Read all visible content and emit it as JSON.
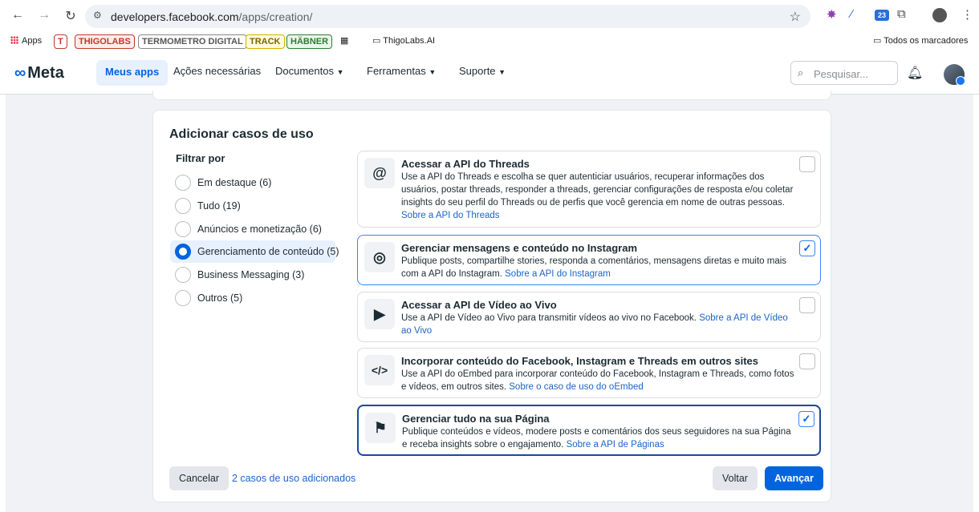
{
  "browser": {
    "url_domain": "developers.facebook.com",
    "url_path": "/apps/creation/",
    "bookmarks": [
      {
        "label": "Apps"
      },
      {
        "label": "T"
      },
      {
        "label": "THIGOLABS"
      },
      {
        "label": "TERMOMETRO DIGITAL"
      },
      {
        "label": "TRACK"
      },
      {
        "label": "HÄBNER"
      },
      {
        "label": "ThigoLabs.AI"
      }
    ],
    "all_bookmarks": "Todos os marcadores",
    "ext_badge": "23"
  },
  "header": {
    "logo": "Meta",
    "nav": [
      "Meus apps",
      "Ações necessárias",
      "Documentos",
      "Ferramentas",
      "Suporte"
    ],
    "search_placeholder": "Pesquisar..."
  },
  "card": {
    "title": "Adicionar casos de uso",
    "filter_title": "Filtrar por",
    "filters": [
      {
        "label": "Em destaque (6)",
        "selected": false
      },
      {
        "label": "Tudo (19)",
        "selected": false
      },
      {
        "label": "Anúncios e monetização (6)",
        "selected": false
      },
      {
        "label": "Gerenciamento de conteúdo (5)",
        "selected": true
      },
      {
        "label": "Business Messaging (3)",
        "selected": false
      },
      {
        "label": "Outros (5)",
        "selected": false
      }
    ],
    "use_cases": [
      {
        "title": "Acessar a API do Threads",
        "desc": "Use a API do Threads e escolha se quer autenticiar usuários, recuperar informações dos usuários, postar threads, responder a threads, gerenciar configurações de resposta e/ou coletar insights do seu perfil do Threads ou de perfis que você gerencia em nome de outras pessoas.",
        "link": "Sobre a API do Threads",
        "icon": "threads-icon",
        "checked": false
      },
      {
        "title": "Gerenciar mensagens e conteúdo no Instagram",
        "desc": "Publique posts, compartilhe stories, responda a comentários, mensagens diretas e muito mais com a API do Instagram.",
        "link": "Sobre a API do Instagram",
        "icon": "instagram-icon",
        "checked": true
      },
      {
        "title": "Acessar a API de Vídeo ao Vivo",
        "desc": "Use a API de Vídeo ao Vivo para transmitir vídeos ao vivo no Facebook.",
        "link": "Sobre a API de Vídeo ao Vivo",
        "icon": "live-video-icon",
        "checked": false
      },
      {
        "title": "Incorporar conteúdo do Facebook, Instagram e Threads em outros sites",
        "desc": "Use a API do oEmbed para incorporar conteúdo do Facebook, Instagram e Threads, como fotos e vídeos, em outros sites.",
        "link": "Sobre o caso de uso do oEmbed",
        "icon": "code-icon",
        "checked": false
      },
      {
        "title": "Gerenciar tudo na sua Página",
        "desc": "Publique conteúdos e vídeos, modere posts e comentários dos seus seguidores na sua Página e receba insights sobre o engajamento.",
        "link": "Sobre a API de Páginas",
        "icon": "flag-icon",
        "checked": true
      }
    ],
    "cancel": "Cancelar",
    "added_count": "2 casos de uso adicionados",
    "back": "Voltar",
    "next": "Avançar"
  }
}
